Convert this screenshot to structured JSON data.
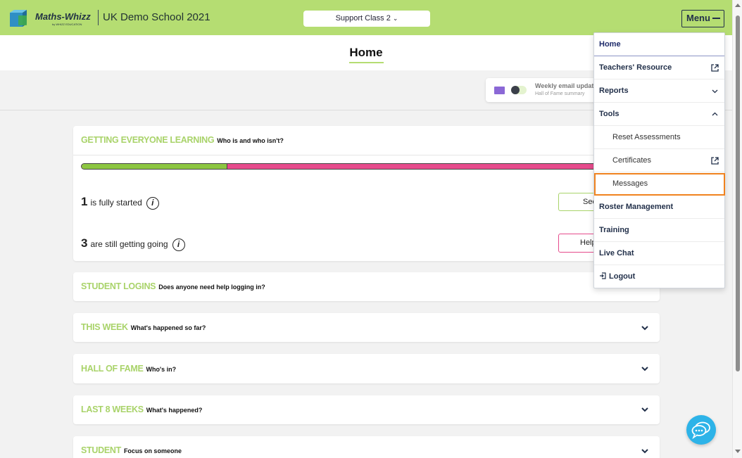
{
  "header": {
    "logo_text": "Maths-Whizz",
    "logo_sub": "by WHIZZ EDUCATION",
    "school_name": "UK Demo School 2021",
    "class_select": "Support Class 2",
    "menu_label": "Menu"
  },
  "page": {
    "title": "Home"
  },
  "email_updates": {
    "title": "Weekly email updat",
    "subtitle": "Hall of Fame summary",
    "enabled": false
  },
  "getting_learning": {
    "heading": "GETTING EVERYONE LEARNING",
    "subheading": "Who is and who isn't?",
    "progress_fraction": 0.28,
    "fully_started_count": "1",
    "fully_started_label": "is fully started",
    "still_going_count": "3",
    "still_going_label": "are still getting going",
    "see_label": "See",
    "help_label": "Help"
  },
  "sections": [
    {
      "heading": "STUDENT LOGINS",
      "subheading": "Does anyone need help logging in?"
    },
    {
      "heading": "THIS WEEK",
      "subheading": "What's happened so far?"
    },
    {
      "heading": "HALL OF FAME",
      "subheading": "Who's in?"
    },
    {
      "heading": "LAST 8 WEEKS",
      "subheading": "What's happened?"
    },
    {
      "heading": "STUDENT",
      "subheading": "Focus on someone"
    }
  ],
  "menu": {
    "items": [
      {
        "label": "Home"
      },
      {
        "label": "Teachers' Resource"
      },
      {
        "label": "Reports"
      },
      {
        "label": "Tools"
      },
      {
        "label": "Reset Assessments"
      },
      {
        "label": "Certificates"
      },
      {
        "label": "Messages"
      },
      {
        "label": "Roster Management"
      },
      {
        "label": "Training"
      },
      {
        "label": "Live Chat"
      },
      {
        "label": "Logout"
      }
    ]
  },
  "colors": {
    "brand_green": "#b5dd72",
    "progress_green": "#8cc641",
    "progress_pink": "#e64b8c",
    "highlight_orange": "#f0821e",
    "chat_blue": "#2db3e8"
  }
}
